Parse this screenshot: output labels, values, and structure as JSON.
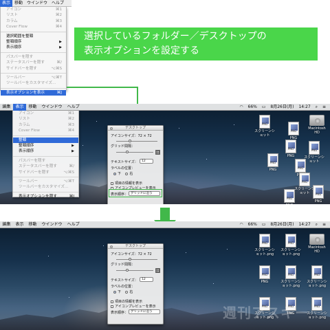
{
  "menubar": {
    "edit": "編集",
    "view": "表示",
    "go": "移動",
    "window": "ウインドウ",
    "help": "ヘルプ",
    "battery": "66%",
    "date": "8月26日(月)",
    "time": "14:27"
  },
  "view_menu": {
    "icon": "アイコン",
    "icon_sc": "⌘1",
    "list": "リスト",
    "list_sc": "⌘2",
    "column": "カラム",
    "column_sc": "⌘3",
    "coverflow": "Cover Flow",
    "coverflow_sc": "⌘4",
    "clean_selection": "選択範囲を整頓",
    "clean": "整頓",
    "clean_by": "整頓順序",
    "sort_by": "表示順序",
    "hide_path_bar": "パスバーを隠す",
    "hide_status_bar": "ステータスバーを隠す",
    "hide_status_bar_sc": "⌘/",
    "hide_sidebar": "サイドバーを隠す",
    "hide_sidebar_sc": "⌥⌘S",
    "toolbar": "ツールバー",
    "toolbar_sc": "⌥⌘T",
    "customize_toolbar": "ツールバーをカスタマイズ...",
    "show_view_options": "表示オプションを表示",
    "show_view_options_sc": "⌘J",
    "hide_view_options": "表示オプションを隠す",
    "hide_view_options_sc": "⌘J"
  },
  "callout": {
    "line1": "選択しているフォルダー／デスクトップの",
    "line2": "表示オプションを設定する"
  },
  "view_options": {
    "title": "デスクトップ",
    "icon_size_label": "アイコンサイズ：72 × 72",
    "grid_spacing_label": "グリッド間隔：",
    "text_size_label": "テキストサイズ：",
    "text_size_value": "12",
    "label_position_label": "ラベルの位置：",
    "label_bottom": "下",
    "label_right": "右",
    "show_item_info": "項目の情報を表示",
    "show_icon_preview": "アイコンプレビューを表示",
    "sort_by_label": "表示順序：",
    "sort_by_value": "グリッドに沿う"
  },
  "desktop": {
    "png": "PNG",
    "screenshot": "スクリーンショット",
    "screenshot_png": "スクリーンショット.png",
    "disk_line1": "Macintosh",
    "disk_line2": "HD"
  },
  "watermark": "週刊アスキー",
  "colors": {
    "accent": "#41b84a",
    "menu_highlight": "#2f6ad8"
  }
}
